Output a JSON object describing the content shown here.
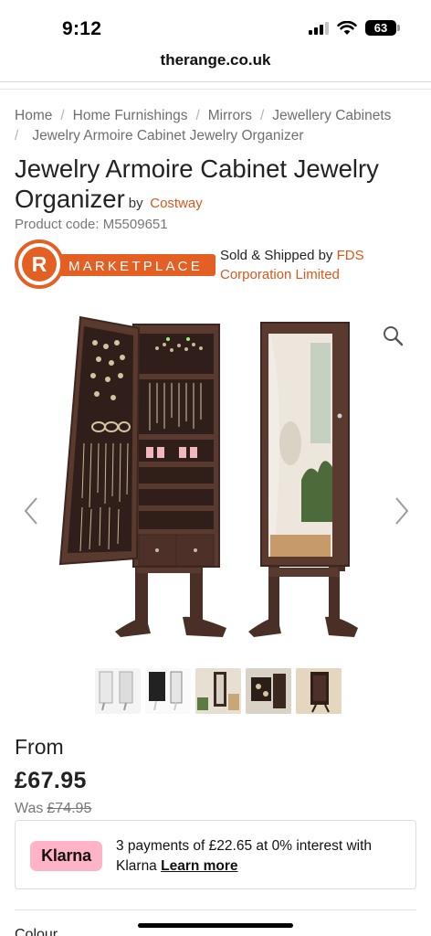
{
  "status_bar": {
    "time": "9:12",
    "battery": "63"
  },
  "browser": {
    "url": "therange.co.uk"
  },
  "breadcrumb": {
    "items": [
      {
        "label": "Home"
      },
      {
        "label": "Home Furnishings"
      },
      {
        "label": "Mirrors"
      },
      {
        "label": "Jewellery Cabinets"
      },
      {
        "label": "Jewelry Armoire Cabinet Jewelry Organizer"
      }
    ],
    "separator": "/"
  },
  "product": {
    "title": "Jewelry Armoire Cabinet Jewelry Organizer",
    "by_label": "by",
    "brand": "Costway",
    "code": "Product code: M5509651"
  },
  "marketplace": {
    "logo_letter": "R",
    "logo_text": "MARKETPLACE",
    "sold_by_prefix": "Sold & Shipped by",
    "seller": "FDS Corporation Limited"
  },
  "gallery": {
    "zoom_icon": "magnifier-icon",
    "prev_icon": "chevron-left-icon",
    "next_icon": "chevron-right-icon",
    "thumbnail_count": 5,
    "colors": {
      "cabinet": "#5a3a2e",
      "cabinet_dark": "#3d2620",
      "mirror": "#ece6dd"
    }
  },
  "pricing": {
    "from_label": "From",
    "price": "£67.95",
    "was_label": "Was",
    "was_price": "£74.95"
  },
  "klarna": {
    "badge": "Klarna",
    "text": "3 payments of £22.65 at 0% interest with Klarna",
    "learn_more": "Learn more",
    "badge_color": "#ffb3c7"
  },
  "next_section": {
    "label": "Colour"
  },
  "colors": {
    "accent": "#d8581c",
    "text": "#222222",
    "muted": "#777777"
  }
}
